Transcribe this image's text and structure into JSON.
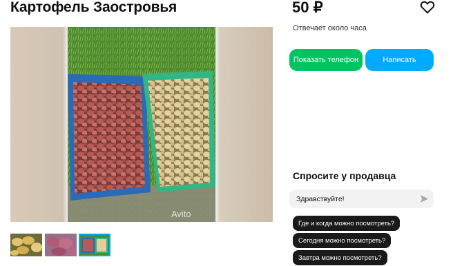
{
  "listing": {
    "title": "Картофель Заостровья",
    "price": "50 ₽",
    "favorite_icon": "heart-outline-icon"
  },
  "seller": {
    "response_time": "Отвечает около часа"
  },
  "actions": {
    "show_phone_label": "Показать телефон",
    "write_label": "Написать"
  },
  "gallery": {
    "main_photo": "potatoes-in-crates-photo",
    "watermark": "Avito",
    "thumbnails": [
      {
        "name": "yellow-potatoes-thumbnail",
        "active": false
      },
      {
        "name": "red-potatoes-sack-thumbnail",
        "active": false
      },
      {
        "name": "potatoes-crates-thumbnail",
        "active": true
      }
    ]
  },
  "ask_seller": {
    "title": "Спросите у продавца",
    "message_value": "Здравствуйте!",
    "send_icon": "send-arrow-icon",
    "quick_questions": [
      "Где и когда можно посмотреть?",
      "Сегодня можно посмотреть?",
      "Завтра можно посмотреть?"
    ]
  },
  "colors": {
    "phone_button": "#00c462",
    "write_button": "#00aaff",
    "chip_background": "#1a1a1a"
  }
}
